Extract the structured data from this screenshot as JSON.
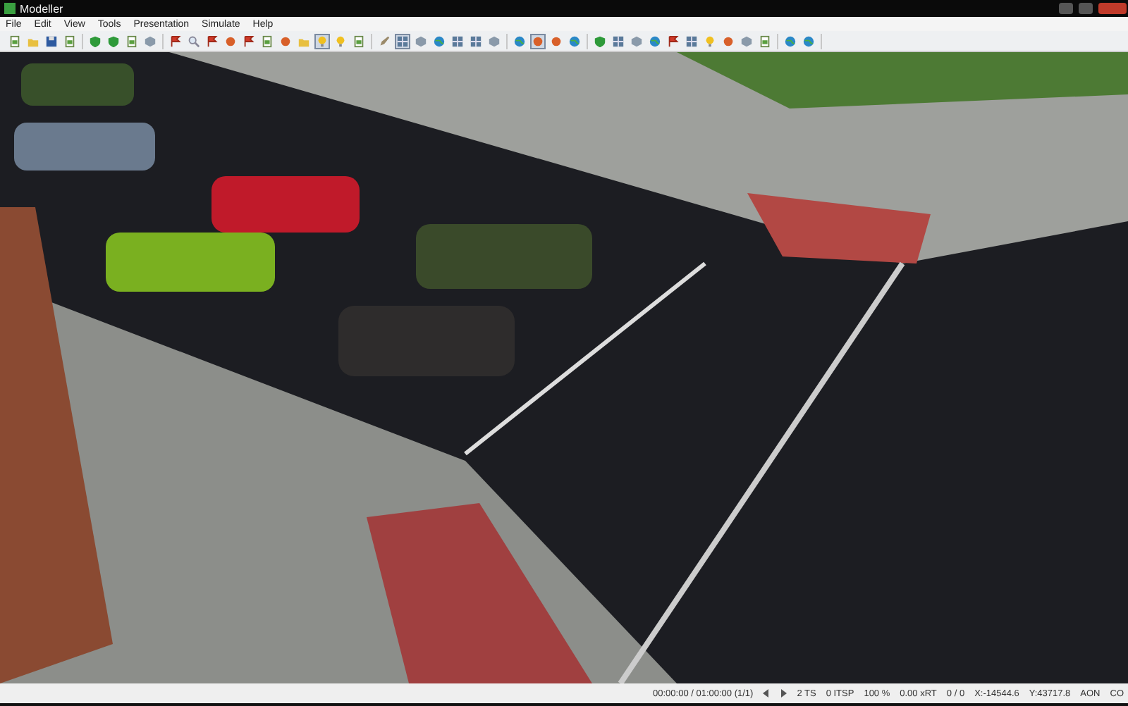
{
  "window": {
    "title": "Modeller"
  },
  "menu": [
    {
      "label": "File"
    },
    {
      "label": "Edit"
    },
    {
      "label": "View"
    },
    {
      "label": "Tools"
    },
    {
      "label": "Presentation"
    },
    {
      "label": "Simulate"
    },
    {
      "label": "Help"
    }
  ],
  "toolbar": [
    [
      {
        "kind": "page",
        "selected": false
      },
      {
        "kind": "folder",
        "selected": false
      },
      {
        "kind": "disk",
        "selected": false
      },
      {
        "kind": "page",
        "selected": false
      }
    ],
    [
      {
        "kind": "shield",
        "selected": false
      },
      {
        "kind": "shield",
        "selected": false
      },
      {
        "kind": "page",
        "selected": false
      },
      {
        "kind": "box",
        "selected": false
      }
    ],
    [
      {
        "kind": "flag",
        "selected": false
      },
      {
        "kind": "magnifier",
        "selected": false
      },
      {
        "kind": "flag",
        "selected": false
      },
      {
        "kind": "dot",
        "selected": false
      },
      {
        "kind": "flag",
        "selected": false
      },
      {
        "kind": "page",
        "selected": false
      },
      {
        "kind": "dot",
        "selected": false
      },
      {
        "kind": "folder",
        "selected": false
      },
      {
        "kind": "bulb",
        "selected": true
      },
      {
        "kind": "bulb",
        "selected": false
      },
      {
        "kind": "page",
        "selected": false
      }
    ],
    [
      {
        "kind": "pencil",
        "selected": false
      },
      {
        "kind": "grid",
        "selected": true
      },
      {
        "kind": "box",
        "selected": false
      },
      {
        "kind": "globe",
        "selected": false
      },
      {
        "kind": "grid",
        "selected": false
      },
      {
        "kind": "grid",
        "selected": false
      },
      {
        "kind": "box",
        "selected": false
      }
    ],
    [
      {
        "kind": "globe",
        "selected": false
      },
      {
        "kind": "dot",
        "selected": true
      },
      {
        "kind": "dot",
        "selected": false
      },
      {
        "kind": "globe",
        "selected": false
      }
    ],
    [
      {
        "kind": "shield",
        "selected": false
      },
      {
        "kind": "grid",
        "selected": false
      },
      {
        "kind": "box",
        "selected": false
      },
      {
        "kind": "globe",
        "selected": false
      },
      {
        "kind": "flag",
        "selected": false
      },
      {
        "kind": "grid",
        "selected": false
      },
      {
        "kind": "bulb",
        "selected": false
      },
      {
        "kind": "dot",
        "selected": false
      },
      {
        "kind": "box",
        "selected": false
      },
      {
        "kind": "page",
        "selected": false
      }
    ],
    [
      {
        "kind": "globe",
        "selected": false
      },
      {
        "kind": "globe",
        "selected": false
      }
    ]
  ],
  "viewport": {
    "kind": "picture"
  },
  "status_bar": [
    {
      "kind": "text",
      "text": "00:00:00 / 01:00:00 (1/1)"
    },
    {
      "kind": "prev"
    },
    {
      "kind": "next"
    },
    {
      "kind": "text",
      "text": "2 TS"
    },
    {
      "kind": "text",
      "text": "0 ITSP"
    },
    {
      "kind": "text",
      "text": "100 %"
    },
    {
      "kind": "text",
      "text": "0.00 xRT"
    },
    {
      "kind": "text",
      "text": "0 / 0"
    },
    {
      "kind": "text",
      "text": "X:-14544.6"
    },
    {
      "kind": "text",
      "text": "Y:43717.8"
    },
    {
      "kind": "text",
      "text": "AON"
    },
    {
      "kind": "text",
      "text": "CO"
    }
  ]
}
